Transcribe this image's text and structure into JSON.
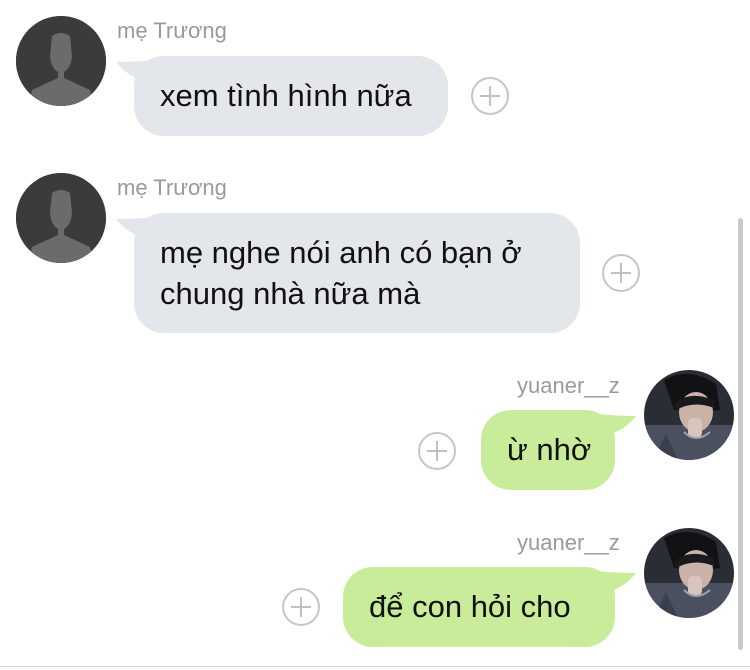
{
  "messages": [
    {
      "sender": "mẹ Trương",
      "text": "xem tình hình nữa",
      "direction": "incoming",
      "avatar_icon": "default-user-silhouette"
    },
    {
      "sender": "mẹ Trương",
      "lines": [
        "mẹ nghe nói anh có bạn ở",
        "chung nhà nữa mà"
      ],
      "direction": "incoming",
      "avatar_icon": "default-user-silhouette"
    },
    {
      "sender": "yuaner__z",
      "text": "ừ nhờ",
      "direction": "outgoing",
      "avatar_icon": "user-photo"
    },
    {
      "sender": "yuaner__z",
      "text": "để con hỏi cho",
      "direction": "outgoing",
      "avatar_icon": "user-photo"
    }
  ],
  "colors": {
    "incoming_bubble": "#e3e6ea",
    "outgoing_bubble": "#c8ec9a",
    "sender_name": "#9a9a9a",
    "background": "#ffffff"
  },
  "icons": {
    "react": "add-reaction-icon",
    "default_avatar": "default-avatar-icon"
  }
}
